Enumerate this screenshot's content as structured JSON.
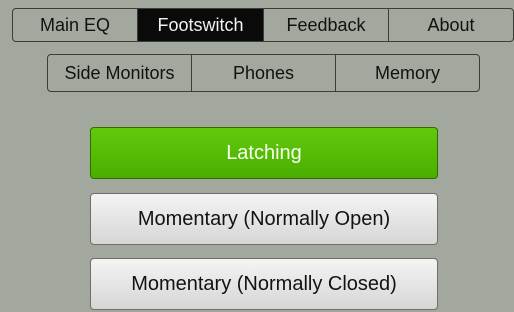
{
  "tabs": [
    {
      "label": "Main EQ",
      "active": false
    },
    {
      "label": "Footswitch",
      "active": true
    },
    {
      "label": "Feedback",
      "active": false
    },
    {
      "label": "About",
      "active": false
    }
  ],
  "subtabs": [
    {
      "label": "Side Monitors"
    },
    {
      "label": "Phones"
    },
    {
      "label": "Memory"
    }
  ],
  "modes": [
    {
      "label": "Latching",
      "selected": true
    },
    {
      "label": "Momentary (Normally Open)",
      "selected": false
    },
    {
      "label": "Momentary (Normally Closed)",
      "selected": false
    }
  ],
  "colors": {
    "background": "#a3a89e",
    "active_tab": "#0a0a0a",
    "selected_button": "#56bb04"
  }
}
